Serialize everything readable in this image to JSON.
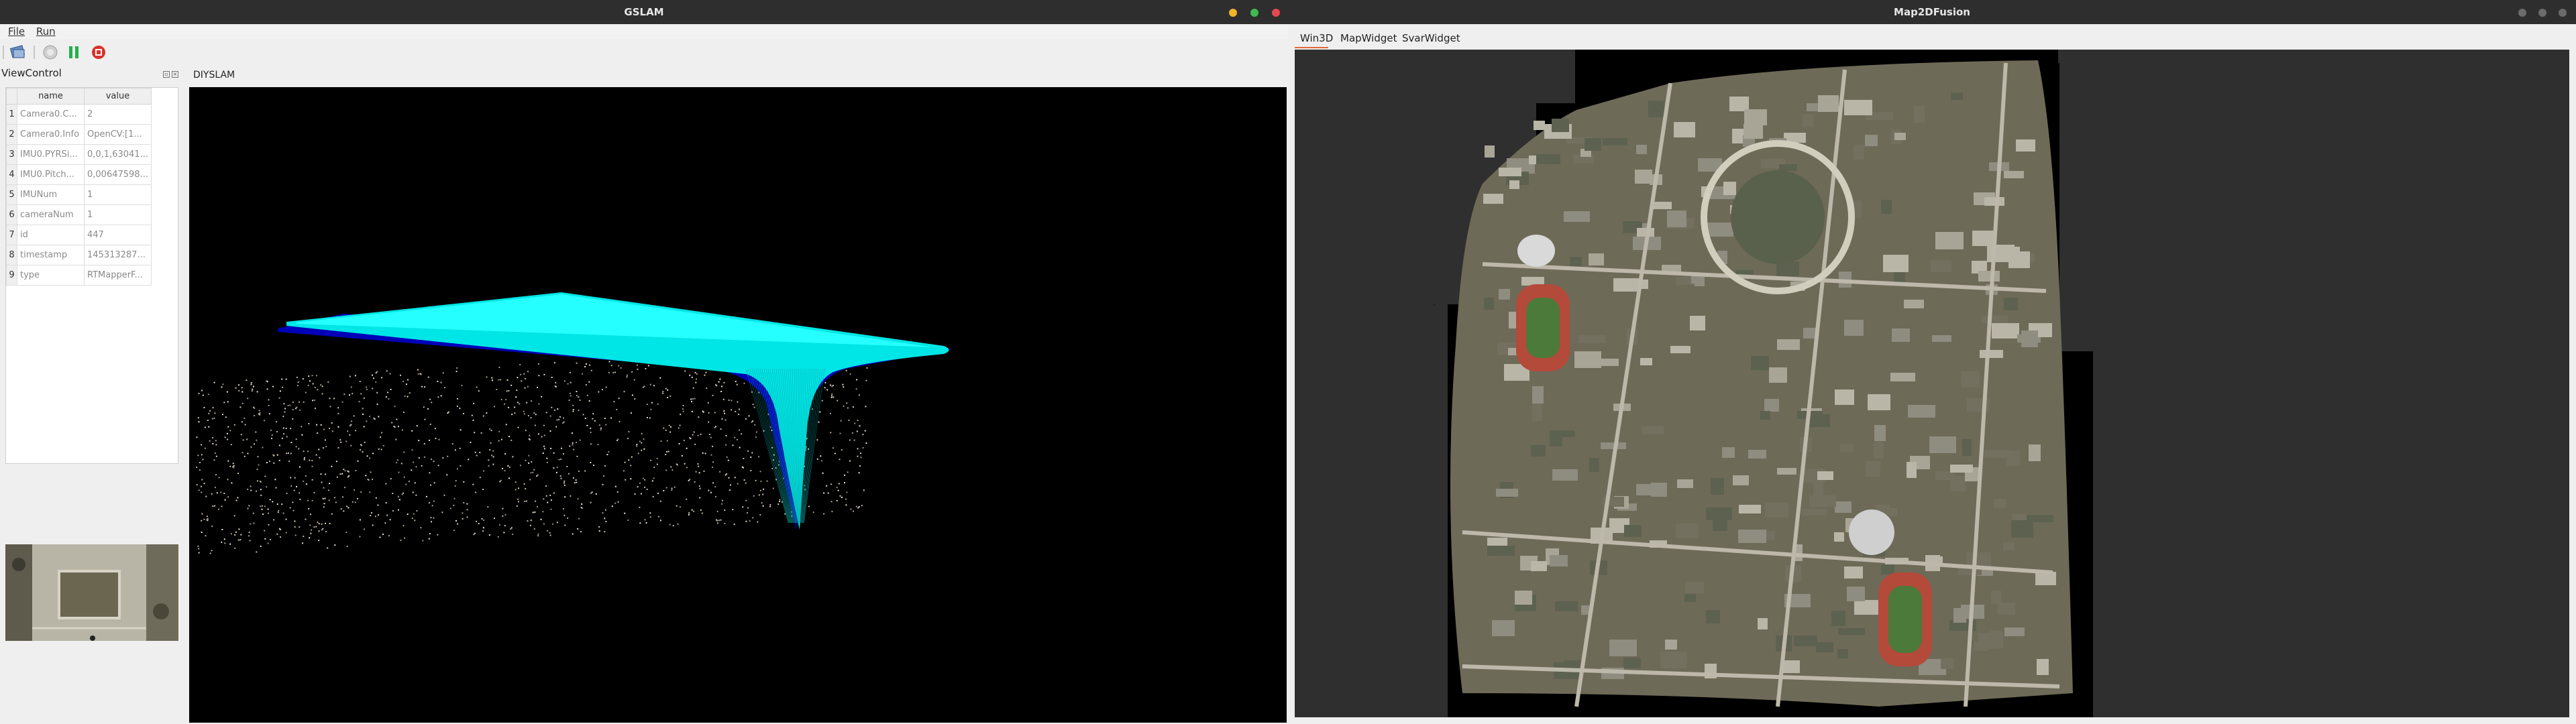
{
  "gslam": {
    "title": "GSLAM",
    "menu": [
      "File",
      "Run"
    ],
    "dock_title": "ViewControl",
    "columns": [
      "name",
      "value"
    ],
    "rows": [
      {
        "n": "1",
        "name": "Camera0.C...",
        "value": "2"
      },
      {
        "n": "2",
        "name": "Camera0.Info",
        "value": "OpenCV:[1..."
      },
      {
        "n": "3",
        "name": "IMU0.PYRSi...",
        "value": "0,0,1,63041..."
      },
      {
        "n": "4",
        "name": "IMU0.Pitch...",
        "value": "0,00647598..."
      },
      {
        "n": "5",
        "name": "IMUNum",
        "value": "1"
      },
      {
        "n": "6",
        "name": "cameraNum",
        "value": "1"
      },
      {
        "n": "7",
        "name": "id",
        "value": "447"
      },
      {
        "n": "8",
        "name": "timestamp",
        "value": "145313287..."
      },
      {
        "n": "9",
        "name": "type",
        "value": "RTMapperF..."
      }
    ],
    "view_tab": "DIYSLAM",
    "colors": {
      "surface": "#00ffff",
      "underside": "#0000cc",
      "bg": "#000000"
    }
  },
  "map2d": {
    "title": "Map2DFusion",
    "tabs": [
      "Win3D",
      "MapWidget",
      "SvarWidget"
    ],
    "active_tab": "Win3D"
  }
}
